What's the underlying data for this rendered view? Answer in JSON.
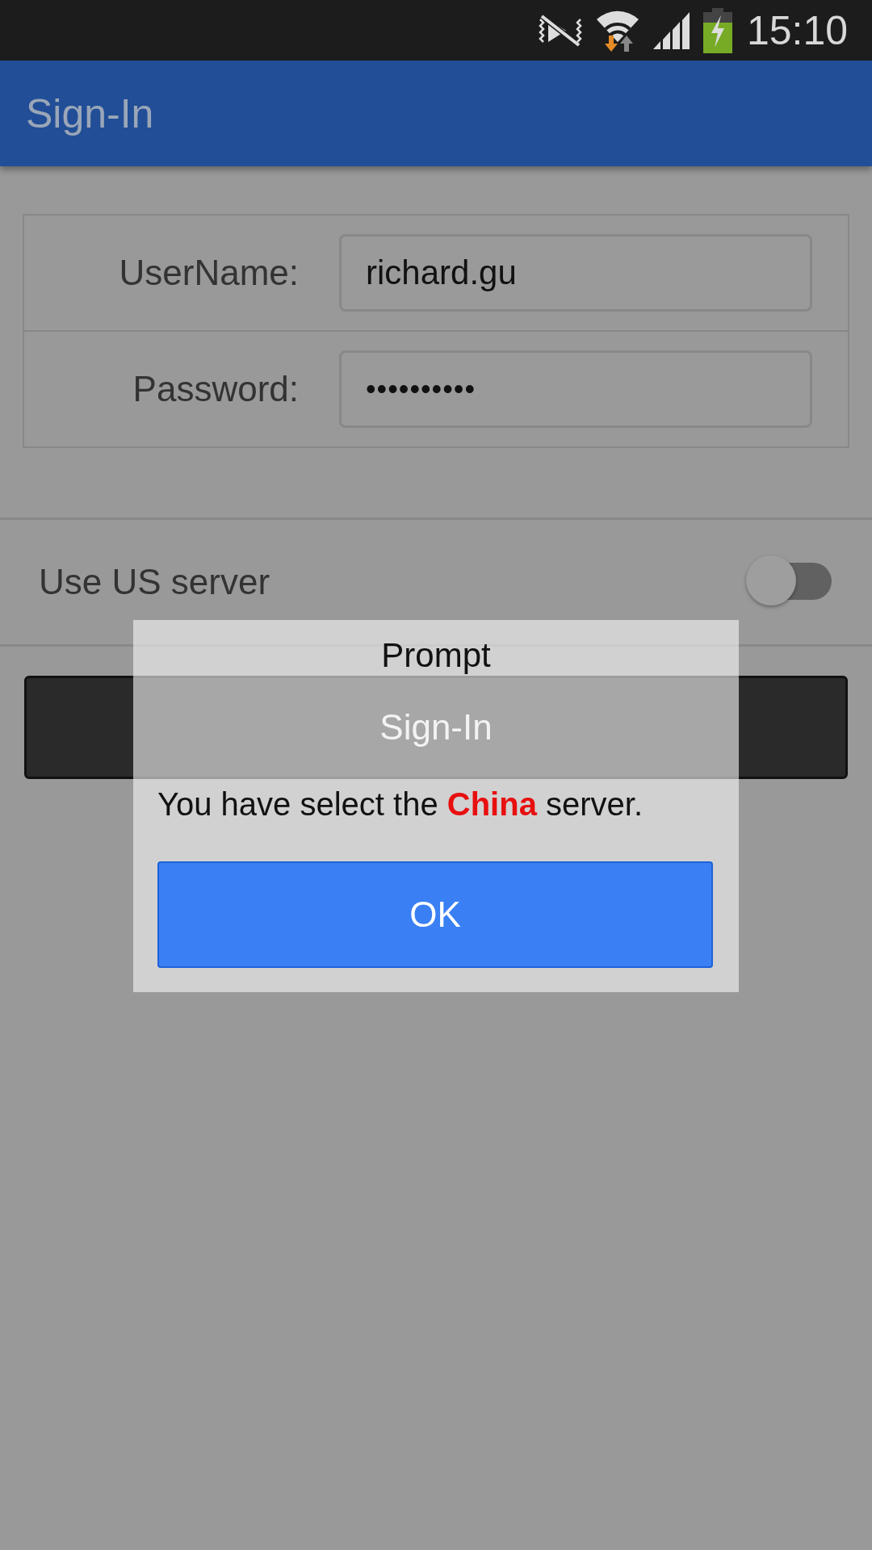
{
  "status_bar": {
    "time": "15:10"
  },
  "app_bar": {
    "title": "Sign-In"
  },
  "form": {
    "fields": [
      {
        "label": "UserName:",
        "value": "richard.gu",
        "kind": "text"
      },
      {
        "label": "Password:",
        "value": "••••••••••",
        "kind": "password"
      }
    ]
  },
  "settings": [
    {
      "label": "Use US server",
      "on": false
    }
  ],
  "sign_in_button": {
    "label": "Sign-In"
  },
  "dialog": {
    "title": "Prompt",
    "message": "You have select the **China** server.",
    "ok_button": "OK"
  }
}
